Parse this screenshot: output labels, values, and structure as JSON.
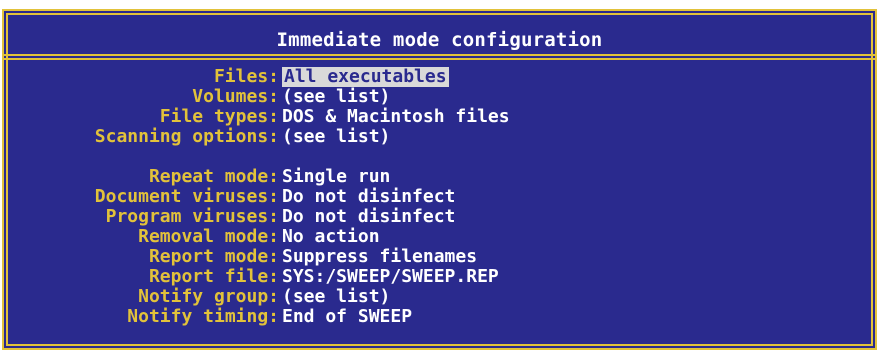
{
  "title": "Immediate mode configuration",
  "settings": [
    {
      "label": "Files:",
      "value": "All executables",
      "selected": true
    },
    {
      "label": "Volumes:",
      "value": "(see list)"
    },
    {
      "label": "File types:",
      "value": "DOS & Macintosh files"
    },
    {
      "label": "Scanning options:",
      "value": "(see list)"
    },
    {
      "label": "Repeat mode:",
      "value": "Single run"
    },
    {
      "label": "Document viruses:",
      "value": "Do not disinfect"
    },
    {
      "label": "Program viruses:",
      "value": "Do not disinfect"
    },
    {
      "label": "Removal mode:",
      "value": "No action"
    },
    {
      "label": "Report mode:",
      "value": "Suppress filenames"
    },
    {
      "label": "Report file:",
      "value": "SYS:/SWEEP/SWEEP.REP"
    },
    {
      "label": "Notify group:",
      "value": "(see list)"
    },
    {
      "label": "Notify timing:",
      "value": "End of SWEEP"
    }
  ],
  "colors": {
    "background": "#2a2a8e",
    "label": "#e2c23a",
    "value": "#ffffff",
    "selection": "#d9d9d9"
  }
}
